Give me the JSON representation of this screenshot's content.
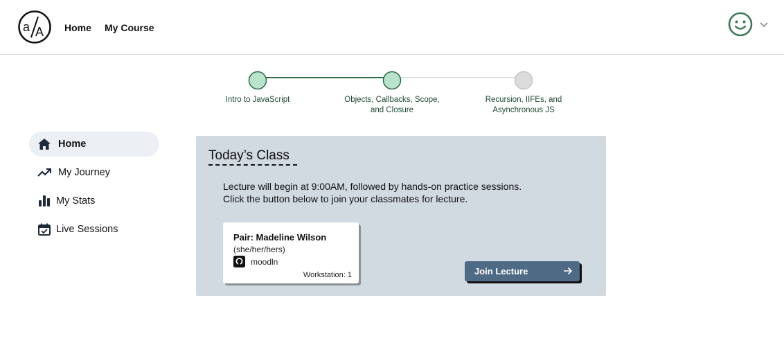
{
  "header": {
    "logo_text": "a/A",
    "nav": [
      {
        "label": "Home"
      },
      {
        "label": "My Course"
      }
    ],
    "avatar_icon": "smiley-face-icon",
    "menu_icon": "chevron-down-icon"
  },
  "progress": {
    "current_index": 1,
    "steps": [
      {
        "label": "Intro to JavaScript",
        "status": "complete"
      },
      {
        "label": "Objects, Callbacks, Scope, and Closure",
        "status": "current"
      },
      {
        "label": "Recursion, IIFEs, and Asynchronous JS",
        "status": "upcoming"
      }
    ]
  },
  "sidebar": {
    "items": [
      {
        "label": "Home",
        "icon": "home-icon",
        "active": true
      },
      {
        "label": "My Journey",
        "icon": "trending-up-icon",
        "active": false
      },
      {
        "label": "My Stats",
        "icon": "bar-chart-icon",
        "active": false
      },
      {
        "label": "Live Sessions",
        "icon": "calendar-check-icon",
        "active": false
      }
    ]
  },
  "today_class": {
    "title": "Today’s Class",
    "lecture_line1": "Lecture will begin at 9:00AM, followed by hands-on practice sessions.",
    "lecture_line2": "Click the button below to join your classmates for lecture.",
    "pair": {
      "name": "Pair: Madeline Wilson",
      "pronouns": "(she/her/hers)",
      "github_username": "moodln",
      "workstation": "Workstation: 1"
    },
    "join_button": "Join Lecture"
  },
  "colors": {
    "accent_green": "#2f6a4a",
    "complete_circle": "#b9e3cb",
    "upcoming_circle": "#dcdcdc",
    "panel_bg": "#d1d9e1",
    "button_bg": "#4e6a85",
    "sidebar_active_bg": "#eceff3"
  }
}
